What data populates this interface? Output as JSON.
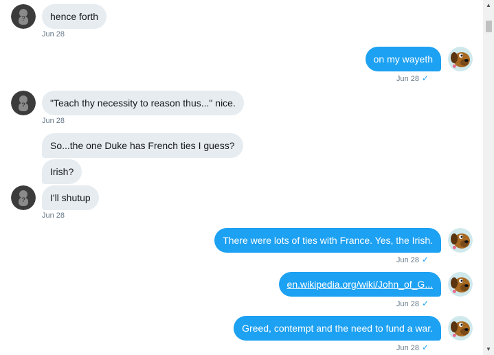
{
  "colors": {
    "outgoing": "#1da1f2",
    "incoming": "#e6ecf0",
    "meta": "#657786"
  },
  "icons": {
    "sent": "checkmark-icon",
    "incoming_avatar": "user-avatar-icon",
    "outgoing_avatar": "dog-avatar-icon",
    "scroll_up": "scroll-up-arrow",
    "scroll_down": "scroll-down-arrow"
  },
  "messages": [
    {
      "text": "hence forth",
      "direction": "in",
      "time": "Jun 28"
    },
    {
      "text": "on my wayeth",
      "direction": "out",
      "time": "Jun 28",
      "status": "✓"
    },
    {
      "text": "\"Teach thy necessity to reason thus...\" nice.",
      "direction": "in",
      "time": "Jun 28"
    },
    {
      "text": "So...the one Duke has French ties I guess?",
      "direction": "in"
    },
    {
      "text": "Irish?",
      "direction": "in"
    },
    {
      "text": "I'll shutup",
      "direction": "in",
      "time": "Jun 28"
    },
    {
      "text": "There were lots of ties with France. Yes, the Irish.",
      "direction": "out",
      "time": "Jun 28",
      "status": "✓"
    },
    {
      "text": "en.wikipedia.org/wiki/John_of_G...",
      "direction": "out",
      "time": "Jun 28",
      "status": "✓",
      "is_link": true
    },
    {
      "text": "Greed, contempt and the need to fund a war.",
      "direction": "out",
      "time": "Jun 28",
      "status": "✓"
    }
  ]
}
